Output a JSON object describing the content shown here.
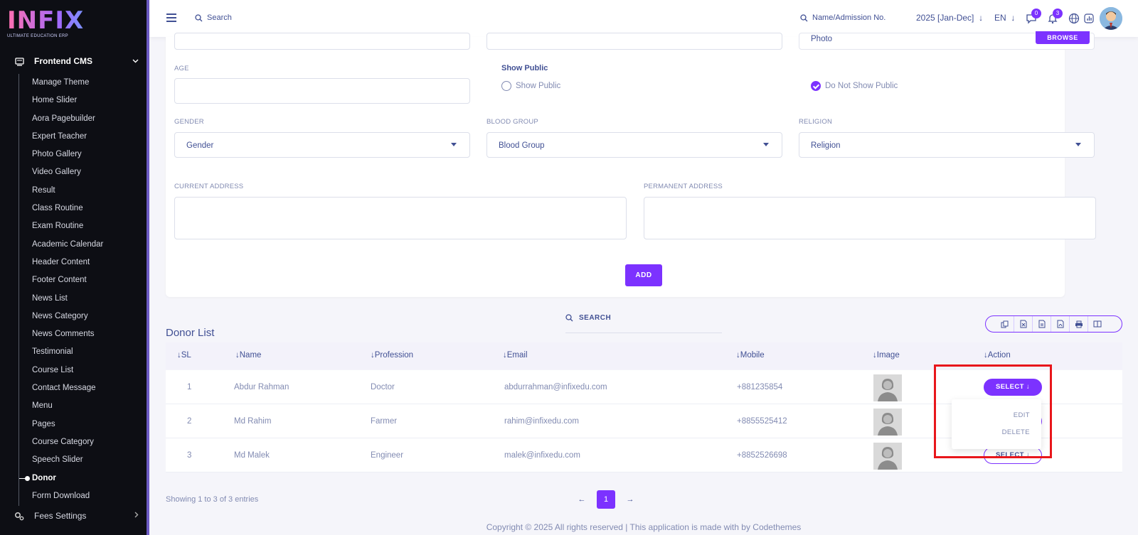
{
  "brand": {
    "name": "INFIX",
    "tagline": "ULTIMATE EDUCATION ERP"
  },
  "sidebar": {
    "parent": "Frontend CMS",
    "items": [
      "Manage Theme",
      "Home Slider",
      "Aora Pagebuilder",
      "Expert Teacher",
      "Photo Gallery",
      "Video Gallery",
      "Result",
      "Class Routine",
      "Exam Routine",
      "Academic Calendar",
      "Header Content",
      "Footer Content",
      "News List",
      "News Category",
      "News Comments",
      "Testimonial",
      "Course List",
      "Contact Message",
      "Menu",
      "Pages",
      "Course Category",
      "Speech Slider",
      "Donor",
      "Form Download"
    ],
    "active": "Donor",
    "next_parent": "Fees Settings"
  },
  "topbar": {
    "search_placeholder": "Search",
    "admission_search": "Name/Admission No.",
    "year": "2025 [Jan-Dec]",
    "lang": "EN",
    "messages_count": "0",
    "notifications_count": "3"
  },
  "form": {
    "photo_placeholder": "Photo",
    "browse_label": "BROWSE",
    "age_label": "AGE",
    "show_public_title": "Show Public",
    "radio_show": "Show Public",
    "radio_hide": "Do Not Show Public",
    "gender_label": "GENDER",
    "gender_value": "Gender",
    "blood_label": "BLOOD GROUP",
    "blood_value": "Blood Group",
    "religion_label": "RELIGION",
    "religion_value": "Religion",
    "current_address_label": "CURRENT ADDRESS",
    "permanent_address_label": "PERMANENT ADDRESS",
    "add_label": "ADD"
  },
  "list": {
    "title": "Donor List",
    "search_label": "SEARCH",
    "columns": [
      "SL",
      "Name",
      "Profession",
      "Email",
      "Mobile",
      "Image",
      "Action"
    ],
    "rows": [
      {
        "sl": "1",
        "name": "Abdur Rahman",
        "profession": "Doctor",
        "email": "abdurrahman@infixedu.com",
        "mobile": "+881235854"
      },
      {
        "sl": "2",
        "name": "Md Rahim",
        "profession": "Farmer",
        "email": "rahim@infixedu.com",
        "mobile": "+8855525412"
      },
      {
        "sl": "3",
        "name": "Md Malek",
        "profession": "Engineer",
        "email": "malek@infixedu.com",
        "mobile": "+8852526698"
      }
    ],
    "select_label": "SELECT",
    "dropdown": {
      "edit": "EDIT",
      "delete": "DELETE"
    },
    "showing": "Showing 1 to 3 of 3 entries",
    "page": "1"
  },
  "footer": "Copyright © 2025 All rights reserved | This application is made with by Codethemes",
  "colors": {
    "accent": "#7c32ff",
    "sidebar_bg": "#0d0e14",
    "highlight": "#e8161b"
  }
}
